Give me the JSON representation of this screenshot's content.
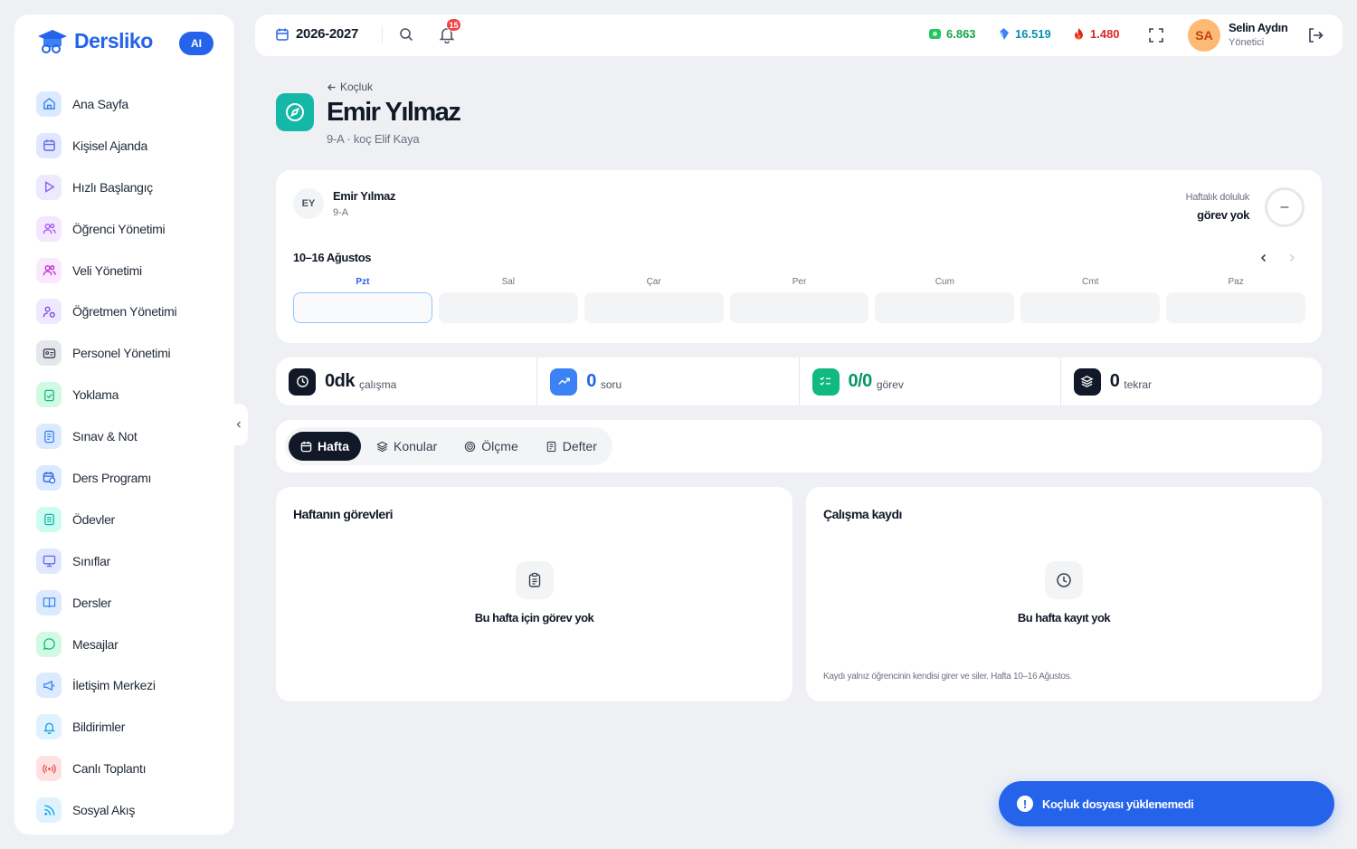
{
  "brand": {
    "name": "Dersliko",
    "ai_label": "AI"
  },
  "nav": [
    {
      "label": "Ana Sayfa",
      "icon": "home-icon",
      "color": "#3b82f6",
      "bg": "#dbeafe"
    },
    {
      "label": "Kişisel Ajanda",
      "icon": "calendar-icon",
      "color": "#6366f1",
      "bg": "#e0e7ff"
    },
    {
      "label": "Hızlı Başlangıç",
      "icon": "play-icon",
      "color": "#8b5cf6",
      "bg": "#ede9fe"
    },
    {
      "label": "Öğrenci Yönetimi",
      "icon": "users-icon",
      "color": "#a855f7",
      "bg": "#f3e8ff"
    },
    {
      "label": "Veli Yönetimi",
      "icon": "users-icon",
      "color": "#c026d3",
      "bg": "#fae8ff"
    },
    {
      "label": "Öğretmen Yönetimi",
      "icon": "teacher-icon",
      "color": "#7c3aed",
      "bg": "#ede9fe"
    },
    {
      "label": "Personel Yönetimi",
      "icon": "id-card-icon",
      "color": "#374151",
      "bg": "#e5e7eb"
    },
    {
      "label": "Yoklama",
      "icon": "clipboard-check-icon",
      "color": "#10b981",
      "bg": "#d1fae5"
    },
    {
      "label": "Sınav & Not",
      "icon": "exam-icon",
      "color": "#3b82f6",
      "bg": "#dbeafe"
    },
    {
      "label": "Ders Programı",
      "icon": "schedule-icon",
      "color": "#2563eb",
      "bg": "#dbeafe"
    },
    {
      "label": "Ödevler",
      "icon": "homework-icon",
      "color": "#14b8a6",
      "bg": "#ccfbf1"
    },
    {
      "label": "Sınıflar",
      "icon": "monitor-icon",
      "color": "#6366f1",
      "bg": "#e0e7ff"
    },
    {
      "label": "Dersler",
      "icon": "book-icon",
      "color": "#3b82f6",
      "bg": "#dbeafe"
    },
    {
      "label": "Mesajlar",
      "icon": "message-icon",
      "color": "#10b981",
      "bg": "#d1fae5"
    },
    {
      "label": "İletişim Merkezi",
      "icon": "megaphone-icon",
      "color": "#3b82f6",
      "bg": "#dbeafe"
    },
    {
      "label": "Bildirimler",
      "icon": "bell-icon",
      "color": "#0ea5e9",
      "bg": "#e0f2fe"
    },
    {
      "label": "Canlı Toplantı",
      "icon": "broadcast-icon",
      "color": "#ef4444",
      "bg": "#fee2e2"
    },
    {
      "label": "Sosyal Akış",
      "icon": "rss-icon",
      "color": "#0ea5e9",
      "bg": "#e0f2fe"
    }
  ],
  "topbar": {
    "year": "2026-2027",
    "notif_count": "15",
    "stats": [
      {
        "value": "6.863",
        "color": "#16a34a",
        "icon": "cash-icon"
      },
      {
        "value": "16.519",
        "color": "#0891b2",
        "icon": "gem-icon"
      },
      {
        "value": "1.480",
        "color": "#dc2626",
        "icon": "fire-icon"
      }
    ],
    "user": {
      "initials": "SA",
      "name": "Selin Aydın",
      "role": "Yönetici"
    }
  },
  "header": {
    "back": "Koçluk",
    "title": "Emir Yılmaz",
    "subtitle": "9-A · koç Elif Kaya"
  },
  "week": {
    "initials": "EY",
    "name": "Emir Yılmaz",
    "class": "9-A",
    "fill_label": "Haftalık doluluk",
    "fill_value": "görev yok",
    "ring": "–",
    "range": "10–16 Ağustos",
    "days": [
      "Pzt",
      "Sal",
      "Çar",
      "Per",
      "Cum",
      "Cmt",
      "Paz"
    ]
  },
  "summary": [
    {
      "value": "0dk",
      "unit": "çalışma",
      "icon": "clock-icon",
      "bg": "#111827"
    },
    {
      "value": "0",
      "unit": "soru",
      "icon": "trend-icon",
      "bg": "#3b82f6",
      "vcolor": "#2563eb"
    },
    {
      "value": "0/0",
      "unit": "görev",
      "icon": "checklist-icon",
      "bg": "#10b981",
      "vcolor": "#059669"
    },
    {
      "value": "0",
      "unit": "tekrar",
      "icon": "layers-icon",
      "bg": "#111827"
    }
  ],
  "tabs": [
    {
      "label": "Hafta"
    },
    {
      "label": "Konular"
    },
    {
      "label": "Ölçme"
    },
    {
      "label": "Defter"
    }
  ],
  "tasks": {
    "title": "Haftanın görevleri",
    "empty": "Bu hafta için görev yok"
  },
  "log": {
    "title": "Çalışma kaydı",
    "empty": "Bu hafta kayıt yok",
    "note": "Kaydı yalnız öğrencinin kendisi girer ve siler. Hafta 10–16 Ağustos."
  },
  "toast": {
    "text": "Koçluk dosyası yüklenemedi"
  }
}
